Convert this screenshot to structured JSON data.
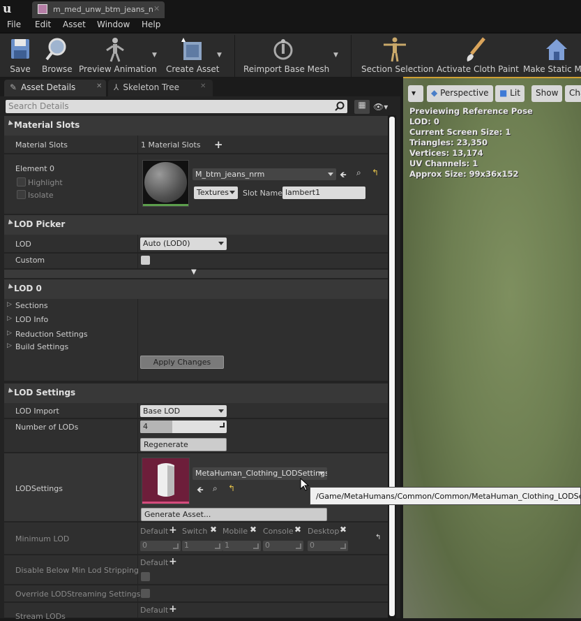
{
  "window": {
    "tab_title": "m_med_unw_btm_jeans_n"
  },
  "menu": [
    "File",
    "Edit",
    "Asset",
    "Window",
    "Help"
  ],
  "toolbar": {
    "items": [
      "Save",
      "Browse",
      "Preview Animation",
      "Create Asset",
      "Reimport Base Mesh",
      "Section Selection",
      "Activate Cloth Paint",
      "Make Static Me"
    ]
  },
  "panels": {
    "tab1": "Asset Details",
    "tab2": "Skeleton Tree"
  },
  "search": {
    "placeholder": "Search Details"
  },
  "material_slots": {
    "header": "Material Slots",
    "label": "Material Slots",
    "count": "1 Material Slots",
    "element_label": "Element 0",
    "highlight": "Highlight",
    "isolate": "Isolate",
    "material": "M_btm_jeans_nrm",
    "textures_btn": "Textures",
    "slot_name_label": "Slot Name",
    "slot_name": "lambert1"
  },
  "lod_picker": {
    "header": "LOD Picker",
    "lod_label": "LOD",
    "lod_value": "Auto (LOD0)",
    "custom_label": "Custom"
  },
  "lod0": {
    "header": "LOD 0",
    "items": [
      "Sections",
      "LOD Info",
      "Reduction Settings",
      "Build Settings"
    ],
    "apply": "Apply Changes"
  },
  "lod_settings": {
    "header": "LOD Settings",
    "import_label": "LOD Import",
    "import_value": "Base LOD",
    "num_label": "Number of LODs",
    "num_value": "4",
    "regenerate": "Regenerate",
    "settings_label": "LODSettings",
    "settings_asset": "MetaHuman_Clothing_LODSettings",
    "generate": "Generate Asset...",
    "min_lod_label": "Minimum LOD",
    "platforms": [
      "Default",
      "Switch",
      "Mobile",
      "Console",
      "Desktop"
    ],
    "platform_values": [
      "0",
      "1",
      "1",
      "0",
      "0"
    ],
    "disable_label": "Disable Below Min Lod Stripping",
    "disable_default": "Default",
    "override_label": "Override LODStreaming Settings",
    "stream_label": "Stream LODs",
    "stream_default": "Default"
  },
  "viewport": {
    "perspective": "Perspective",
    "lit": "Lit",
    "show": "Show",
    "cha": "Cha",
    "info": [
      "Previewing Reference Pose",
      "LOD: 0",
      "Current Screen Size: 1",
      "Triangles: 23,350",
      "Vertices: 13,174",
      "UV Channels: 1",
      "Approx Size: 99x36x152"
    ]
  },
  "tooltip": "/Game/MetaHumans/Common/Common/MetaHuman_Clothing_LODSettings"
}
